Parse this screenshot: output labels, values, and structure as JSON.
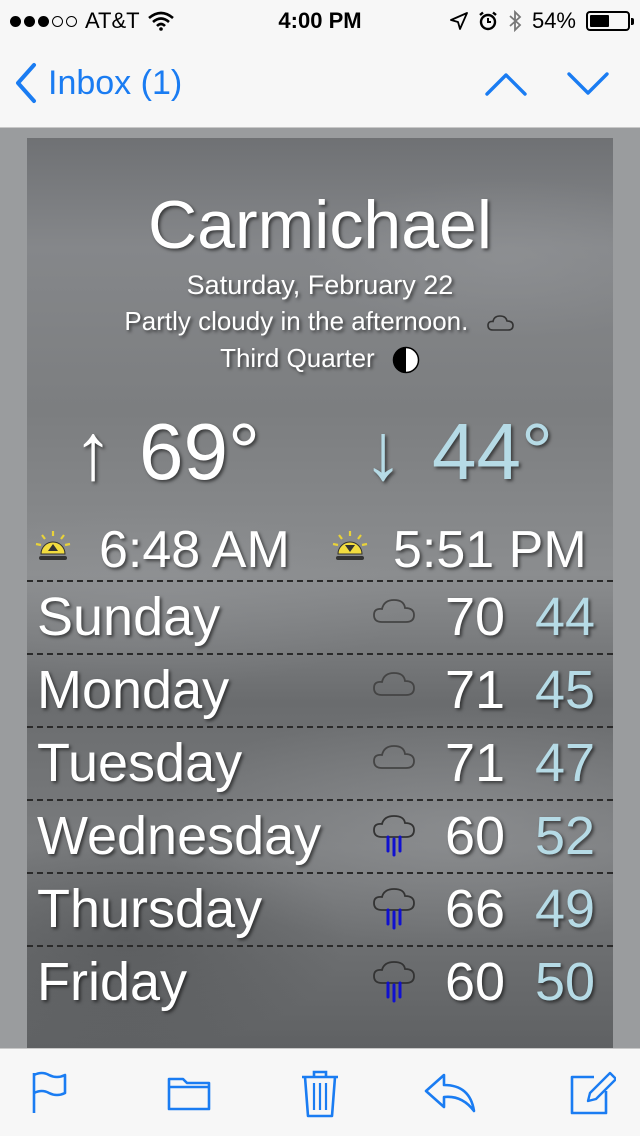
{
  "status_bar": {
    "carrier": "AT&T",
    "time": "4:00 PM",
    "battery": "54%",
    "battery_level": 0.54
  },
  "nav": {
    "back_label": "Inbox (1)",
    "accent": "#1a7cf2"
  },
  "weather": {
    "city": "Carmichael",
    "date": "Saturday, February 22",
    "summary": "Partly cloudy in the afternoon.",
    "summary_icon": "cloud-icon",
    "moon_phase": "Third Quarter",
    "moon_icon": "moon-third-quarter-icon",
    "high_arrow": "↑",
    "high": "69°",
    "low_arrow": "↓",
    "low": "44°",
    "sunrise": "6:48 AM",
    "sunset": "5:51 PM",
    "low_color": "#b6dbe6",
    "forecast": [
      {
        "day": "Sunday",
        "icon": "cloud-icon",
        "hi": "70",
        "lo": "44"
      },
      {
        "day": "Monday",
        "icon": "cloud-icon",
        "hi": "71",
        "lo": "45"
      },
      {
        "day": "Tuesday",
        "icon": "cloud-icon",
        "hi": "71",
        "lo": "47"
      },
      {
        "day": "Wednesday",
        "icon": "rain-icon",
        "hi": "60",
        "lo": "52"
      },
      {
        "day": "Thursday",
        "icon": "rain-icon",
        "hi": "66",
        "lo": "49"
      },
      {
        "day": "Friday",
        "icon": "rain-icon",
        "hi": "60",
        "lo": "50"
      }
    ]
  },
  "toolbar": {
    "items": [
      "flag-icon",
      "folder-icon",
      "trash-icon",
      "reply-icon",
      "compose-icon"
    ]
  }
}
